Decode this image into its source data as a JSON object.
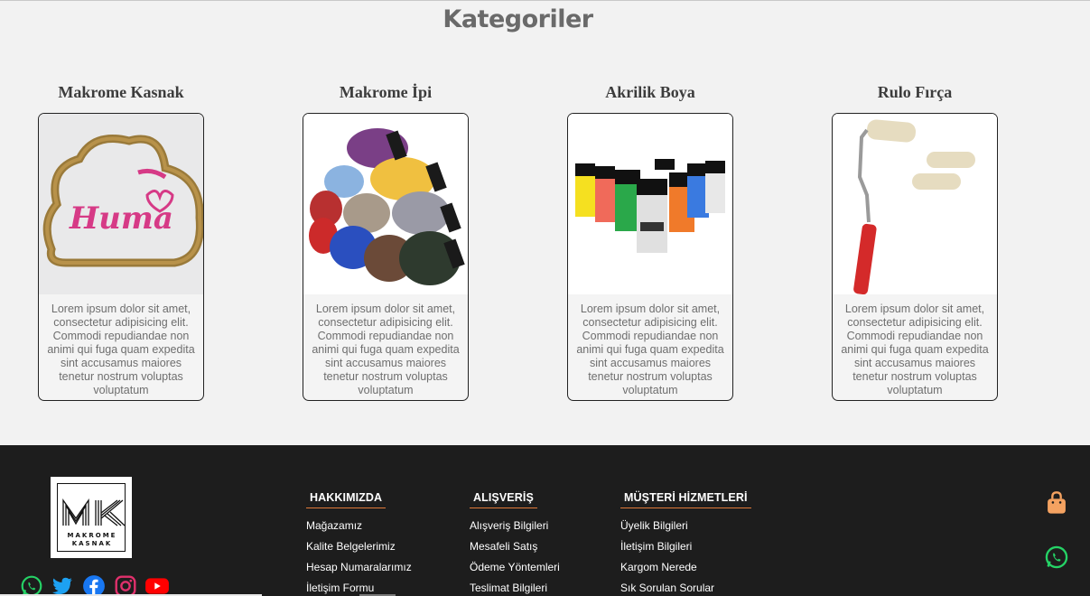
{
  "section": {
    "title": "Kategoriler"
  },
  "categories": [
    {
      "title": "Makrome Kasnak",
      "image_text": "Huma",
      "description": "Lorem ipsum dolor sit amet, consectetur adipisicing elit. Commodi repudiandae non animi qui fuga quam expedita sint accusamus maiores tenetur nostrum voluptas voluptatum"
    },
    {
      "title": "Makrome İpi",
      "description": "Lorem ipsum dolor sit amet, consectetur adipisicing elit. Commodi repudiandae non animi qui fuga quam expedita sint accusamus maiores tenetur nostrum voluptas voluptatum"
    },
    {
      "title": "Akrilik Boya",
      "description": "Lorem ipsum dolor sit amet, consectetur adipisicing elit. Commodi repudiandae non animi qui fuga quam expedita sint accusamus maiores tenetur nostrum voluptas voluptatum"
    },
    {
      "title": "Rulo Fırça",
      "description": "Lorem ipsum dolor sit amet, consectetur adipisicing elit. Commodi repudiandae non animi qui fuga quam expedita sint accusamus maiores tenetur nostrum voluptas voluptatum"
    }
  ],
  "footer": {
    "logo": {
      "monogram": "MK",
      "line1": "MAKROME",
      "line2": "KASNAK"
    },
    "social_icons": [
      "whatsapp-icon",
      "twitter-icon",
      "facebook-icon",
      "instagram-icon",
      "youtube-icon"
    ],
    "columns": [
      {
        "heading": "HAKKIMIZDA",
        "links": [
          "Mağazamız",
          "Kalite Belgelerimiz",
          "Hesap Numaralarımız",
          "İletişim Formu"
        ]
      },
      {
        "heading": "ALIŞVERİŞ",
        "links": [
          "Alışveriş Bilgileri",
          "Mesafeli Satış",
          "Ödeme Yöntemleri",
          "Teslimat Bilgileri"
        ]
      },
      {
        "heading": "MÜŞTERİ HİZMETLERİ",
        "links": [
          "Üyelik Bilgileri",
          "İletişim Bilgileri",
          "Kargom Nerede",
          "Sık Sorulan Sorular"
        ]
      }
    ],
    "side_icons": [
      "shopping-bag-icon",
      "whatsapp-icon"
    ]
  },
  "colors": {
    "footer_bg": "#1d1d1d",
    "accent_orange": "#e07a3a",
    "bag_icon": "#f4a261",
    "whatsapp_green": "#25d366",
    "twitter_blue": "#1da1f2",
    "facebook_blue": "#1877f2",
    "instagram_pink": "#e1306c",
    "youtube_red": "#ff0000"
  }
}
